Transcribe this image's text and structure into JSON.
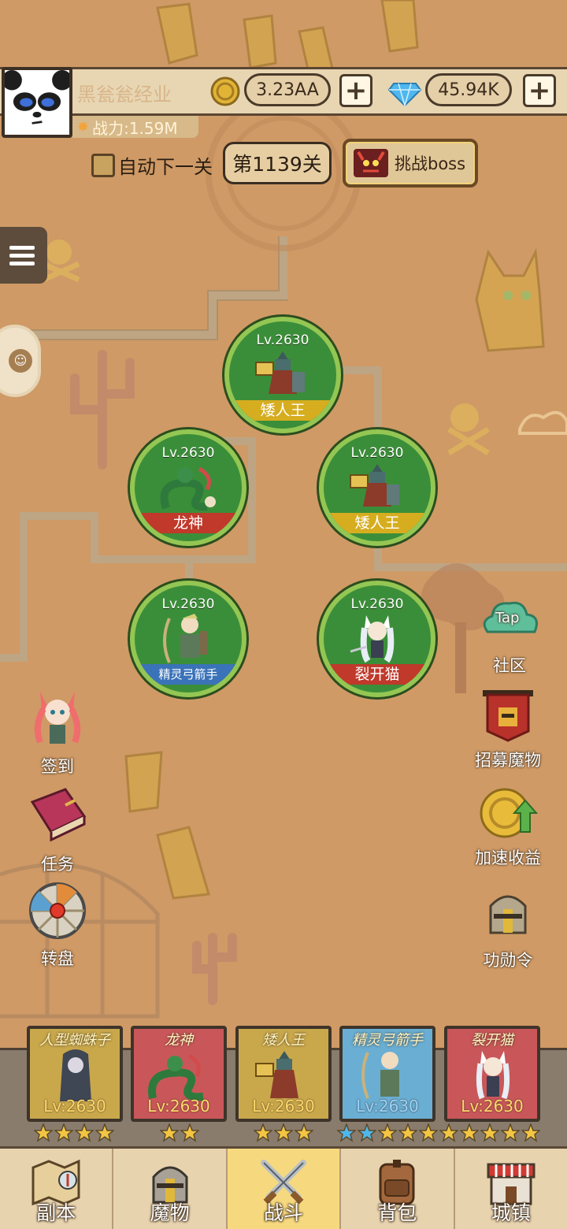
{
  "player": {
    "name": "黑瓮瓮经业",
    "power": "战力:1.59M",
    "gold": "3.23AA",
    "gems": "45.94K"
  },
  "controls": {
    "auto_next": "自动下一关",
    "stage": "第1139关",
    "boss_button": "挑战boss"
  },
  "heroes": [
    {
      "level": "Lv.2630",
      "name": "矮人王",
      "tag_color": "yellow"
    },
    {
      "level": "Lv.2630",
      "name": "龙神",
      "tag_color": "red"
    },
    {
      "level": "Lv.2630",
      "name": "矮人王",
      "tag_color": "yellow"
    },
    {
      "level": "Lv.2630",
      "name": "精灵弓箭手",
      "tag_color": "blue"
    },
    {
      "level": "Lv.2630",
      "name": "裂开猫",
      "tag_color": "red"
    }
  ],
  "right_menu": {
    "community": "社区",
    "community_badge": "Tap",
    "recruit": "招募魔物",
    "speedup": "加速收益",
    "medal": "功勋令"
  },
  "left_menu": {
    "checkin": "签到",
    "tasks": "任务",
    "wheel": "转盘"
  },
  "team": [
    {
      "name": "人型蜘蛛子",
      "level": "Lv:2630",
      "stars": 4,
      "bg": "#c9a84c"
    },
    {
      "name": "龙神",
      "level": "Lv:2630",
      "stars": 2,
      "bg": "#c9575a"
    },
    {
      "name": "矮人王",
      "level": "Lv:2630",
      "stars": 3,
      "bg": "#c9a84c"
    },
    {
      "name": "精灵弓箭手",
      "level": "Lv:2630",
      "stars": 10,
      "blue_stars": 2,
      "bg": "#6aaed3"
    },
    {
      "name": "裂开猫",
      "level": "Lv:2630",
      "stars": 0,
      "bg": "#c9575a"
    }
  ],
  "nav": {
    "dungeon": "副本",
    "monsters": "魔物",
    "battle": "战斗",
    "bag": "背包",
    "town": "城镇",
    "active": "battle"
  }
}
